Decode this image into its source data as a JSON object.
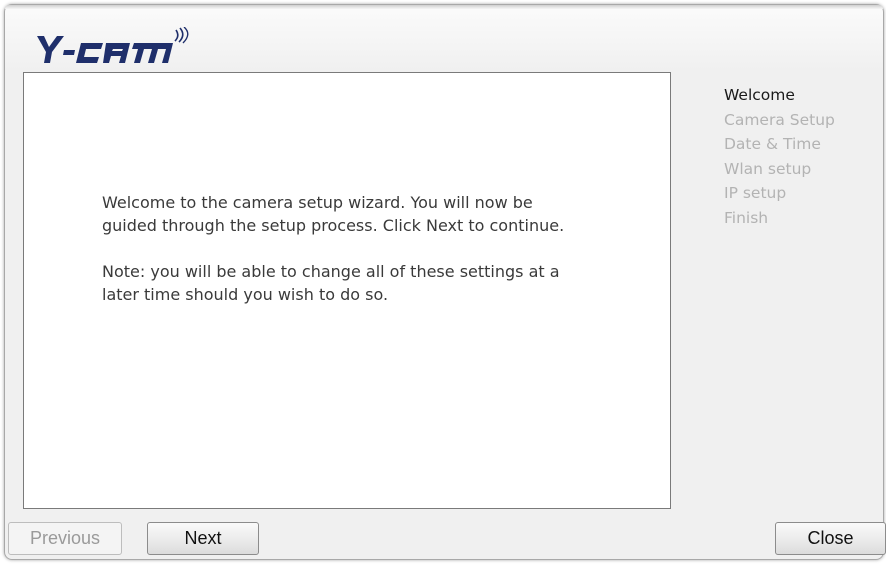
{
  "brand": {
    "logo_text": "Y-cam",
    "logo_color": "#1f2f6b"
  },
  "wizard": {
    "intro_text": "Welcome to the camera setup wizard. You will now be guided through the setup process. Click Next to continue.",
    "note_text": "Note: you will be able to change all of these settings at a later time should you wish to do so."
  },
  "steps": [
    {
      "label": "Welcome",
      "active": true
    },
    {
      "label": "Camera Setup",
      "active": false
    },
    {
      "label": "Date & Time",
      "active": false
    },
    {
      "label": "Wlan setup",
      "active": false
    },
    {
      "label": "IP setup",
      "active": false
    },
    {
      "label": "Finish",
      "active": false
    }
  ],
  "buttons": {
    "previous_label": "Previous",
    "previous_enabled": false,
    "next_label": "Next",
    "close_label": "Close"
  },
  "colors": {
    "active_step": "#1a1a1a",
    "inactive_step": "#b3b3b3"
  }
}
